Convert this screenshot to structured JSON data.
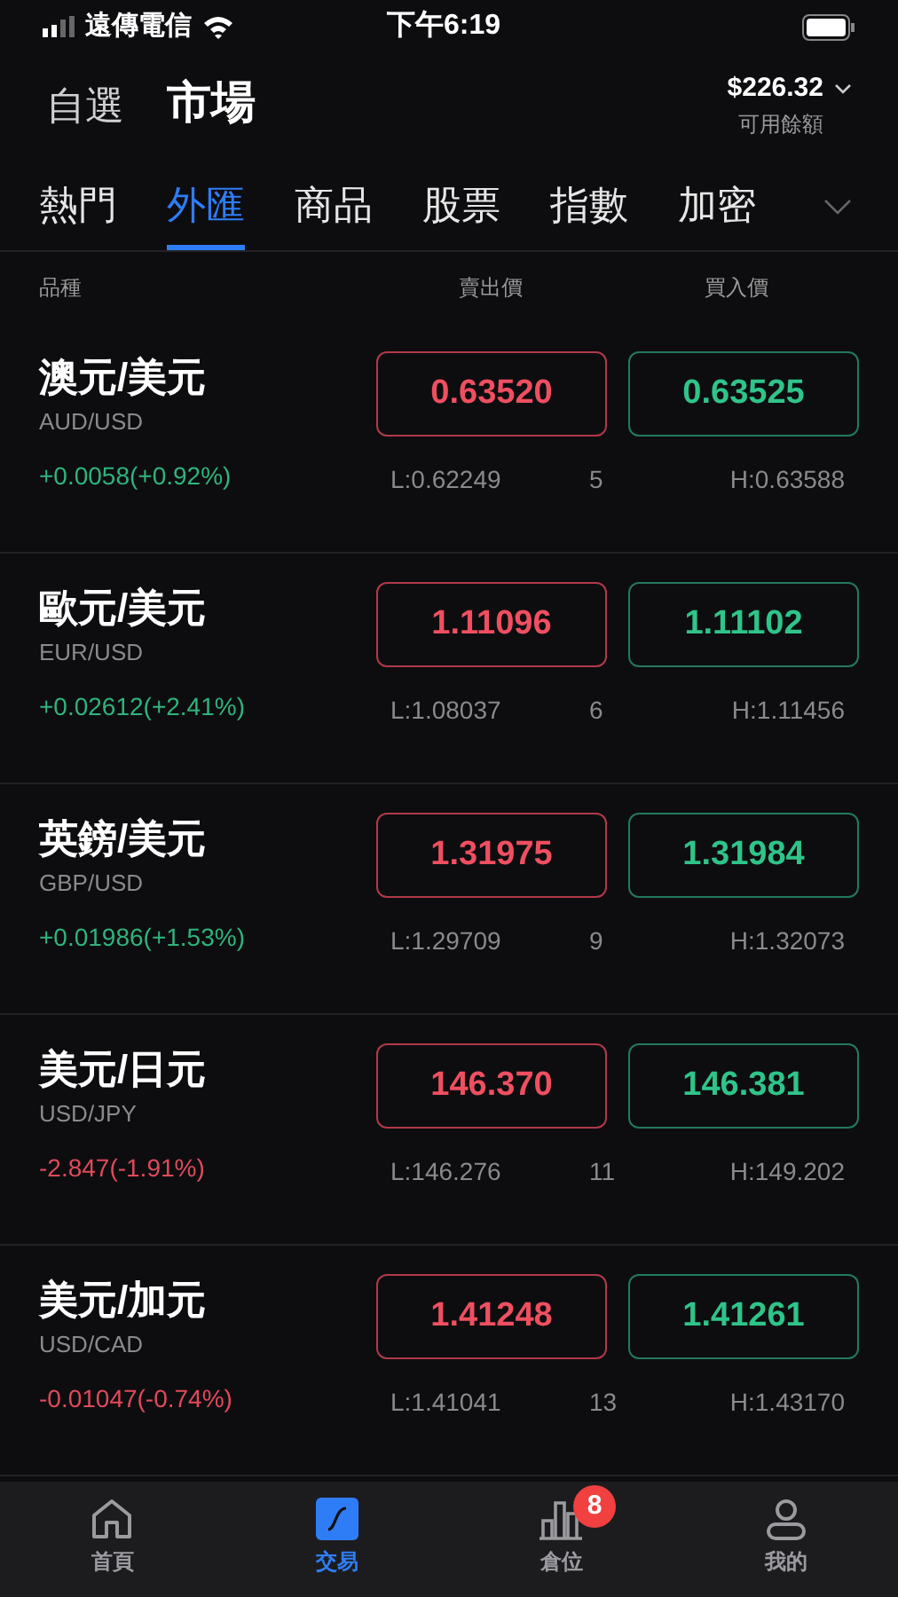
{
  "status_bar": {
    "carrier": "遠傳電信",
    "time": "下午6:19"
  },
  "header": {
    "tabs": [
      {
        "label": "自選",
        "selected": false
      },
      {
        "label": "市場",
        "selected": true
      }
    ],
    "balance": "$226.32",
    "balance_label": "可用餘額"
  },
  "categories": [
    {
      "label": "熱門",
      "selected": false
    },
    {
      "label": "外匯",
      "selected": true
    },
    {
      "label": "商品",
      "selected": false
    },
    {
      "label": "股票",
      "selected": false
    },
    {
      "label": "指數",
      "selected": false
    },
    {
      "label": "加密",
      "selected": false
    }
  ],
  "table": {
    "columns": [
      "品種",
      "賣出價",
      "買入價"
    ],
    "rows": [
      {
        "name": "澳元/美元",
        "symbol": "AUD/USD",
        "change": "+0.0058(+0.92%)",
        "kind": "up",
        "sell": "0.63520",
        "buy": "0.63525",
        "low": "L:0.62249",
        "spread": "5",
        "high": "H:0.63588"
      },
      {
        "name": "歐元/美元",
        "symbol": "EUR/USD",
        "change": "+0.02612(+2.41%)",
        "kind": "up",
        "sell": "1.11096",
        "buy": "1.11102",
        "low": "L:1.08037",
        "spread": "6",
        "high": "H:1.11456"
      },
      {
        "name": "英鎊/美元",
        "symbol": "GBP/USD",
        "change": "+0.01986(+1.53%)",
        "kind": "up",
        "sell": "1.31975",
        "buy": "1.31984",
        "low": "L:1.29709",
        "spread": "9",
        "high": "H:1.32073"
      },
      {
        "name": "美元/日元",
        "symbol": "USD/JPY",
        "change": "-2.847(-1.91%)",
        "kind": "down",
        "sell": "146.370",
        "buy": "146.381",
        "low": "L:146.276",
        "spread": "11",
        "high": "H:149.202"
      },
      {
        "name": "美元/加元",
        "symbol": "USD/CAD",
        "change": "-0.01047(-0.74%)",
        "kind": "down",
        "sell": "1.41248",
        "buy": "1.41261",
        "low": "L:1.41041",
        "spread": "13",
        "high": "H:1.43170"
      }
    ]
  },
  "nav": [
    {
      "kind": "home",
      "label": "首頁",
      "selected": false
    },
    {
      "kind": "trade",
      "label": "交易",
      "selected": true
    },
    {
      "kind": "positions",
      "label": "倉位",
      "selected": false,
      "badge": "8"
    },
    {
      "kind": "profile",
      "label": "我的",
      "selected": false
    }
  ]
}
